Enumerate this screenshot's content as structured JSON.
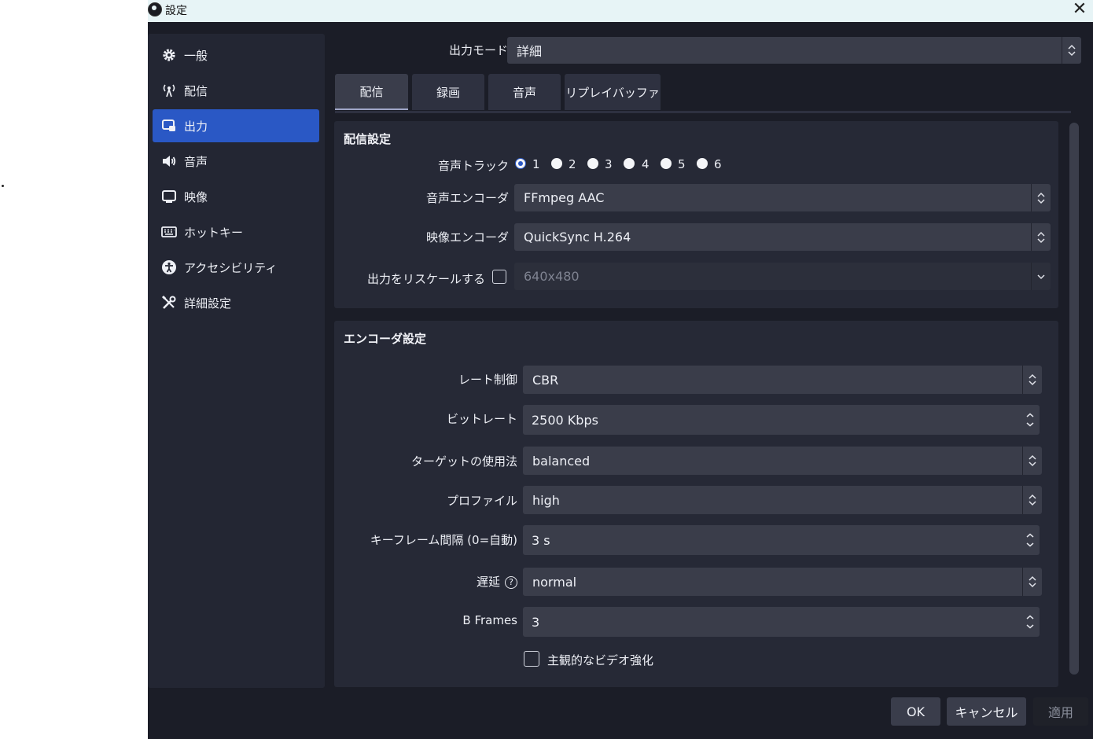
{
  "titlebar": {
    "title": "設定"
  },
  "sidebar": {
    "items": [
      {
        "label": "一般",
        "icon": "gear-icon"
      },
      {
        "label": "配信",
        "icon": "antenna-icon"
      },
      {
        "label": "出力",
        "icon": "output-icon"
      },
      {
        "label": "音声",
        "icon": "speaker-icon"
      },
      {
        "label": "映像",
        "icon": "monitor-icon"
      },
      {
        "label": "ホットキー",
        "icon": "keyboard-icon"
      },
      {
        "label": "アクセシビリティ",
        "icon": "accessibility-icon"
      },
      {
        "label": "詳細設定",
        "icon": "wrench-screwdriver-icon"
      }
    ],
    "active_index": 2
  },
  "output_mode": {
    "label": "出力モード",
    "value": "詳細"
  },
  "tabs": [
    {
      "label": "配信",
      "active": true
    },
    {
      "label": "録画",
      "active": false
    },
    {
      "label": "音声",
      "active": false
    },
    {
      "label": "リプレイバッファ",
      "active": false
    }
  ],
  "stream_settings": {
    "title": "配信設定",
    "audio_track_label": "音声トラック",
    "audio_tracks": [
      "1",
      "2",
      "3",
      "4",
      "5",
      "6"
    ],
    "audio_track_selected": "1",
    "audio_encoder_label": "音声エンコーダ",
    "audio_encoder_value": "FFmpeg AAC",
    "video_encoder_label": "映像エンコーダ",
    "video_encoder_value": "QuickSync H.264",
    "rescale_label": "出力をリスケールする",
    "rescale_checked": false,
    "rescale_value": "640x480"
  },
  "encoder_settings": {
    "title": "エンコーダ設定",
    "rate_control_label": "レート制御",
    "rate_control_value": "CBR",
    "bitrate_label": "ビットレート",
    "bitrate_value": "2500 Kbps",
    "target_usage_label": "ターゲットの使用法",
    "target_usage_value": "balanced",
    "profile_label": "プロファイル",
    "profile_value": "high",
    "keyframe_label": "キーフレーム間隔 (0=自動)",
    "keyframe_value": "3 s",
    "latency_label": "遅延",
    "latency_help": "?",
    "latency_value": "normal",
    "bframes_label": "B Frames",
    "bframes_value": "3",
    "subjective_label": "主観的なビデオ強化",
    "subjective_checked": false
  },
  "buttons": {
    "ok": "OK",
    "cancel": "キャンセル",
    "apply": "適用"
  },
  "colors": {
    "accent": "#2a58c5",
    "window_bg": "#1b1d27",
    "panel_bg": "#262936",
    "input_bg": "#3a3d4a"
  }
}
